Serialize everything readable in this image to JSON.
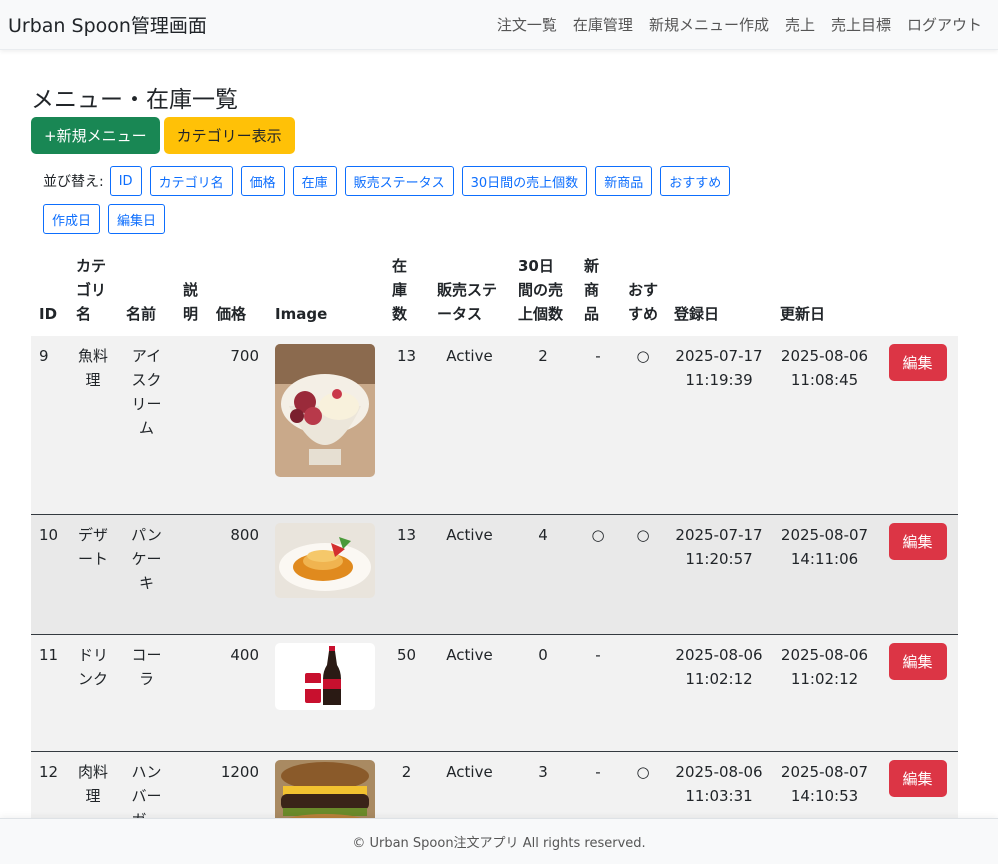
{
  "navbar": {
    "brand": "Urban Spoon管理画面",
    "links": [
      "注文一覧",
      "在庫管理",
      "新規メニュー作成",
      "売上",
      "売上目標",
      "ログアウト"
    ]
  },
  "page": {
    "title": "メニュー・在庫一覧",
    "new_menu_button": "+新規メニュー",
    "category_button": "カテゴリー表示"
  },
  "sort": {
    "label": "並び替え:",
    "buttons": [
      "ID",
      "カテゴリ名",
      "価格",
      "在庫",
      "販売ステータス",
      "30日間の売上個数",
      "新商品",
      "おすすめ",
      "作成日",
      "編集日"
    ]
  },
  "table": {
    "headers": {
      "id": "ID",
      "category": "カテゴリ名",
      "name": "名前",
      "description": "説明",
      "price": "価格",
      "image": "Image",
      "stock": "在庫数",
      "status": "販売ステータス",
      "sales": "30日間の売上個数",
      "new": "新商品",
      "recommend": "おすすめ",
      "created": "登録日",
      "updated": "更新日"
    },
    "edit_label": "編集",
    "rows": [
      {
        "id": "9",
        "category": "魚料理",
        "name": "アイスクリーム",
        "description": "",
        "price": "700",
        "image": "ice-cream-photo",
        "stock": "13",
        "status": "Active",
        "sales": "2",
        "new": "-",
        "recommend": "○",
        "created": "2025-07-17 11:19:39",
        "updated": "2025-08-06 11:08:45"
      },
      {
        "id": "10",
        "category": "デザート",
        "name": "パンケーキ",
        "description": "",
        "price": "800",
        "image": "pancake-photo",
        "stock": "13",
        "status": "Active",
        "sales": "4",
        "new": "○",
        "recommend": "○",
        "created": "2025-07-17 11:20:57",
        "updated": "2025-08-07 14:11:06"
      },
      {
        "id": "11",
        "category": "ドリンク",
        "name": "コーラ",
        "description": "",
        "price": "400",
        "image": "cola-photo",
        "stock": "50",
        "status": "Active",
        "sales": "0",
        "new": "-",
        "recommend": "",
        "created": "2025-08-06 11:02:12",
        "updated": "2025-08-06 11:02:12"
      },
      {
        "id": "12",
        "category": "肉料理",
        "name": "ハンバーガー",
        "description": "",
        "price": "1200",
        "image": "burger-photo",
        "stock": "2",
        "status": "Active",
        "sales": "3",
        "new": "-",
        "recommend": "○",
        "created": "2025-08-06 11:03:31",
        "updated": "2025-08-07 14:10:53"
      }
    ]
  },
  "footer": {
    "text": "© Urban Spoon注文アプリ All rights reserved."
  }
}
